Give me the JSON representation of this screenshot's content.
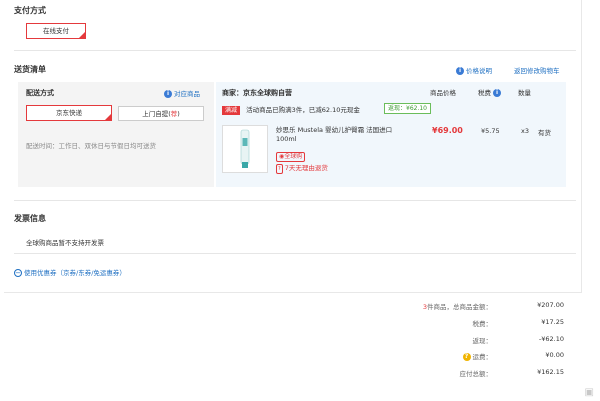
{
  "payment": {
    "title": "支付方式",
    "online_label": "在线支付"
  },
  "shipping": {
    "title": "送货清单",
    "price_note": "价格说明",
    "back_cart": "返回修改购物车",
    "method_label": "配送方式",
    "related_items": "对应商品",
    "jd_express": "京东快递",
    "pickup_text": "上门自提",
    "pickup_badge": "荐",
    "delivery_time": "配送时间：工作日、双休日与节假日均可送货"
  },
  "order": {
    "seller": "商家：京东全球购自营",
    "col_price": "商品价格",
    "col_tax": "税费",
    "col_qty": "数量",
    "promo_tag": "满减",
    "promo_text": "活动商品已购满3件，已减62.10元现金",
    "promo_badge": "返现：¥62.10",
    "item": {
      "name_line1": "妙思乐 Mustela 婴幼儿护臀霜 法国进口",
      "name_line2": "100ml",
      "price": "¥69.00",
      "tax": "¥5.75",
      "qty": "x3",
      "stock": "有货",
      "global_badge": "全球购",
      "no_return": "7天无理由退货"
    }
  },
  "invoice": {
    "title": "发票信息",
    "text": "全球购商品暂不支持开发票"
  },
  "coupon": {
    "text": "使用优惠券（京券/东券/免运惠券）"
  },
  "summary": {
    "count_num": "3",
    "count_text": "件商品，总商品金额：",
    "total": "¥207.00",
    "tax_label": "税费：",
    "tax": "¥17.25",
    "cashback_label": "返现：",
    "cashback": "-¥62.10",
    "shipping_label": "运费：",
    "shipping": "¥0.00",
    "payable_label": "应付总额：",
    "payable": "¥162.15"
  },
  "colors": {
    "accent": "#e4393c",
    "link": "#1e6fc2"
  }
}
